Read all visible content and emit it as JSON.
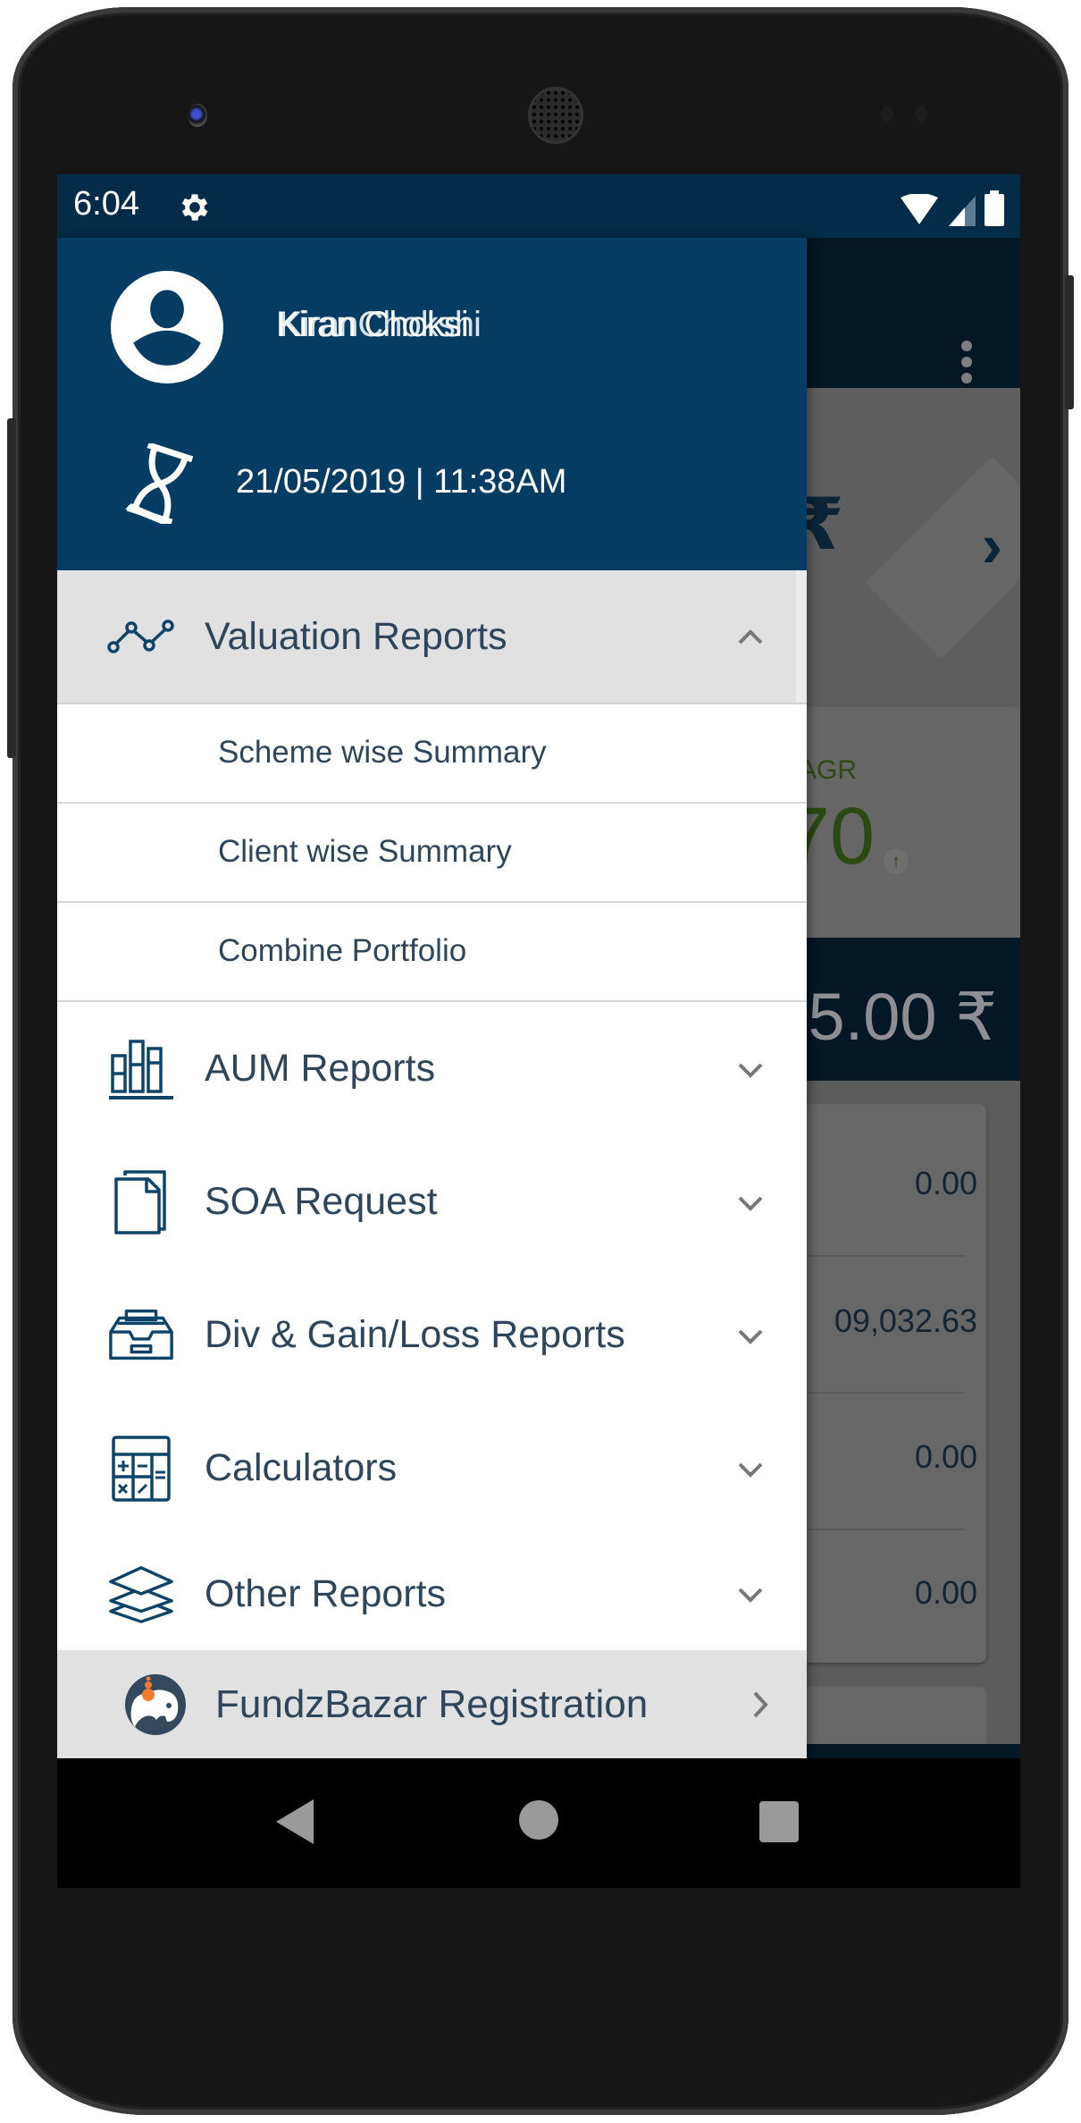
{
  "status_bar": {
    "time": "6:04",
    "icons": [
      "gear-icon",
      "wifi-icon",
      "signal-icon",
      "battery-icon"
    ]
  },
  "drawer": {
    "header": {
      "user_name": "Kiran Choksi",
      "user_name_overlay": "KiranChokshi",
      "last_login": "21/05/2019 | 11:38AM",
      "icons": [
        "avatar-icon",
        "hourglass-icon"
      ]
    },
    "menu": [
      {
        "label": "Valuation Reports",
        "icon": "line-chart-icon",
        "expanded": true,
        "children": [
          {
            "label": "Scheme wise Summary"
          },
          {
            "label": "Client wise Summary"
          },
          {
            "label": "Combine Portfolio"
          }
        ]
      },
      {
        "label": "AUM Reports",
        "icon": "bar-chart-icon",
        "expanded": false
      },
      {
        "label": "SOA Request",
        "icon": "documents-icon",
        "expanded": false
      },
      {
        "label": "Div & Gain/Loss Reports",
        "icon": "archive-tray-icon",
        "expanded": false
      },
      {
        "label": "Calculators",
        "icon": "calculator-icon",
        "expanded": false
      },
      {
        "label": "Other Reports",
        "icon": "layers-icon",
        "expanded": false
      }
    ],
    "footer_item": {
      "label": "FundzBazar Registration",
      "icon": "fundzbazar-logo-icon"
    }
  },
  "background_app": {
    "cagr_label": "AGR",
    "cagr_value": "70",
    "total_value": ".5.00 ₹",
    "rupee_symbol": "₹",
    "next_symbol": "›",
    "rows": [
      "0.00",
      "09,032.63",
      "0.00",
      "0.00"
    ]
  },
  "colors": {
    "status_bar": "#042b47",
    "drawer_header": "#053c63",
    "menu_text": "#2f455a",
    "expanded_bg": "#e1e1e1",
    "cagr_green": "#2b4a12",
    "fundzbazar_orange": "#ef7d2d"
  }
}
